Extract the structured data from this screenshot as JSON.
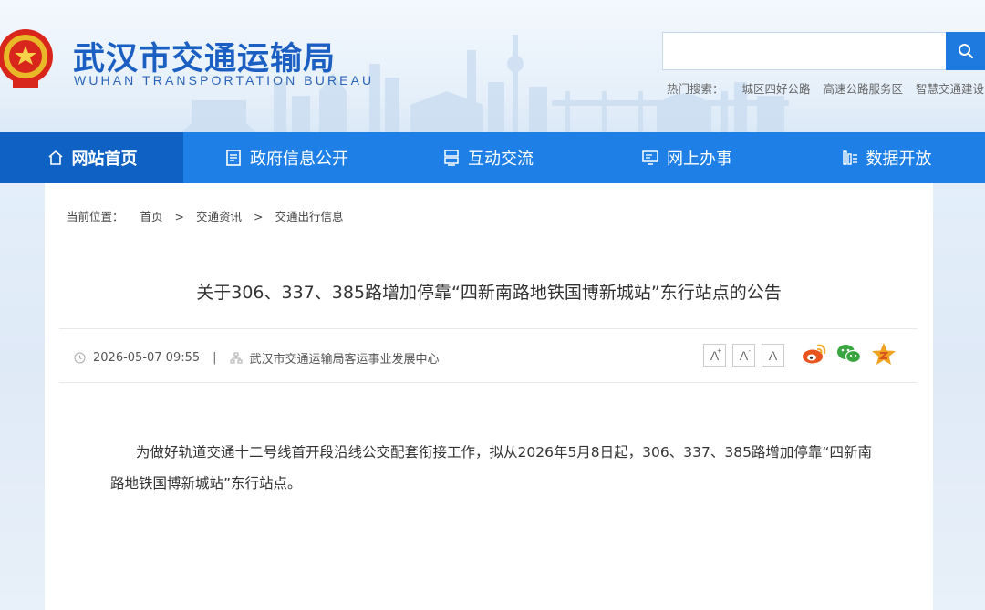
{
  "header": {
    "logo_cn": "武汉市交通运输局",
    "logo_en": "WUHAN TRANSPORTATION BUREAU",
    "search_placeholder": "",
    "hot_label": "热门搜索：",
    "hot_keywords": [
      "城区四好公路",
      "高速公路服务区",
      "智慧交通建设"
    ]
  },
  "nav": [
    {
      "label": "网站首页",
      "icon": "home-icon",
      "active": true
    },
    {
      "label": "政府信息公开",
      "icon": "document-icon"
    },
    {
      "label": "互动交流",
      "icon": "interaction-icon"
    },
    {
      "label": "网上办事",
      "icon": "online-service-icon"
    },
    {
      "label": "数据开放",
      "icon": "data-icon"
    }
  ],
  "breadcrumb": {
    "label": "当前位置：",
    "items": [
      "首页",
      "交通资讯",
      "交通出行信息"
    ],
    "separator": ">"
  },
  "article": {
    "title": "关于306、337、385路增加停靠“四新南路地铁国博新城站”东行站点的公告",
    "date": "2026-05-07 09:55",
    "divider": "|",
    "source": "武汉市交通运输局客运事业发展中心",
    "font_sizes": [
      "A",
      "A",
      "A"
    ],
    "body": "为做好轨道交通十二号线首开段沿线公交配套衔接工作，拟从2026年5月8日起，306、337、385路增加停靠“四新南路地铁国博新城站”东行站点。"
  },
  "colors": {
    "brand": "#1e80e6",
    "nav_active": "#0f62c4",
    "logo": "#1a5fc1"
  }
}
